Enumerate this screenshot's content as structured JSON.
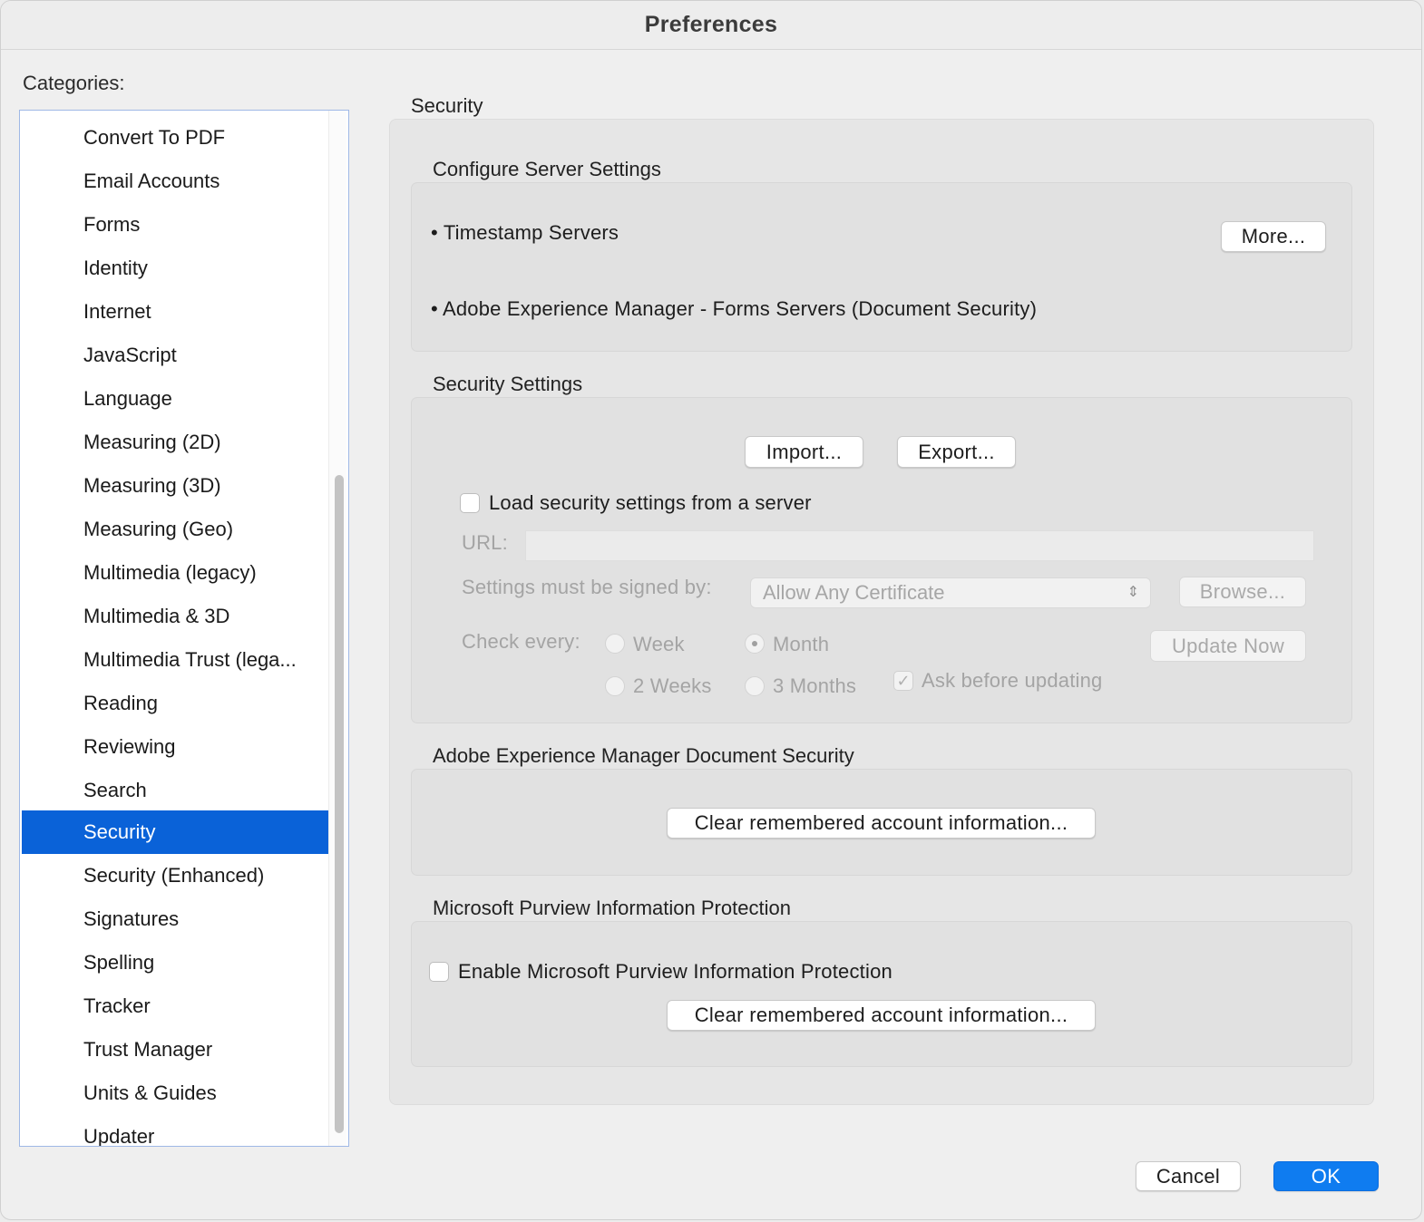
{
  "window": {
    "title": "Preferences"
  },
  "sidebar": {
    "label": "Categories:",
    "items": [
      {
        "label": "Convert To PDF"
      },
      {
        "label": "Email Accounts"
      },
      {
        "label": "Forms"
      },
      {
        "label": "Identity"
      },
      {
        "label": "Internet"
      },
      {
        "label": "JavaScript"
      },
      {
        "label": "Language"
      },
      {
        "label": "Measuring (2D)"
      },
      {
        "label": "Measuring (3D)"
      },
      {
        "label": "Measuring (Geo)"
      },
      {
        "label": "Multimedia (legacy)"
      },
      {
        "label": "Multimedia & 3D"
      },
      {
        "label": "Multimedia Trust (lega..."
      },
      {
        "label": "Reading"
      },
      {
        "label": "Reviewing"
      },
      {
        "label": "Search"
      },
      {
        "label": "Security",
        "selected": true
      },
      {
        "label": "Security (Enhanced)"
      },
      {
        "label": "Signatures"
      },
      {
        "label": "Spelling"
      },
      {
        "label": "Tracker"
      },
      {
        "label": "Trust Manager"
      },
      {
        "label": "Units & Guides"
      },
      {
        "label": "Updater"
      }
    ]
  },
  "main": {
    "title": "Security",
    "server": {
      "title": "Configure Server Settings",
      "timestamp": "• Timestamp Servers",
      "more_button": "More...",
      "aem": "• Adobe Experience Manager - Forms Servers (Document Security)"
    },
    "security_settings": {
      "title": "Security Settings",
      "import_button": "Import...",
      "export_button": "Export...",
      "load_checkbox": "Load security settings from a server",
      "url_label": "URL:",
      "url_value": "",
      "signed_label": "Settings must be signed by:",
      "signed_value": "Allow Any Certificate",
      "browse_button": "Browse...",
      "check_label": "Check every:",
      "radio_week": "Week",
      "radio_month": "Month",
      "radio_2weeks": "2 Weeks",
      "radio_3months": "3 Months",
      "selected_interval": "Month",
      "update_button": "Update Now",
      "ask_checkbox": "Ask before updating",
      "ask_checked": true
    },
    "aem_security": {
      "title": "Adobe Experience Manager Document Security",
      "clear_button": "Clear remembered account information..."
    },
    "purview": {
      "title": "Microsoft Purview Information Protection",
      "enable_checkbox": "Enable Microsoft Purview Information Protection",
      "clear_button": "Clear remembered account information..."
    }
  },
  "footer": {
    "cancel": "Cancel",
    "ok": "OK"
  }
}
